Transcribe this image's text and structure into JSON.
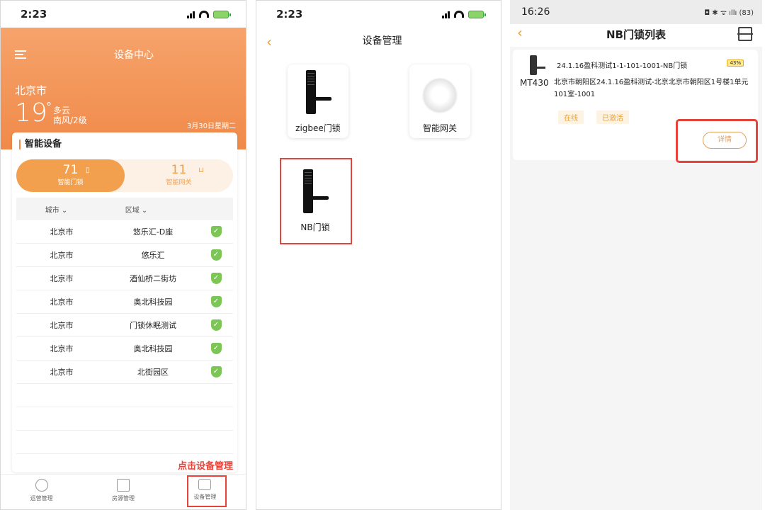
{
  "screen1": {
    "time": "2:23",
    "title": "设备中心",
    "city": "北京市",
    "temperature": "19",
    "degree": "°",
    "weather": "多云",
    "wind": "南风/2级",
    "date": "3月30日星期二",
    "card_title": "智能设备",
    "tab_locks_count": "71",
    "tab_locks_label": "智能门锁",
    "tab_gateways_count": "11",
    "tab_gateways_label": "智能网关",
    "col_city": "城市",
    "col_area": "区域",
    "rows": [
      {
        "city": "北京市",
        "area": "悠乐汇-D座"
      },
      {
        "city": "北京市",
        "area": "悠乐汇"
      },
      {
        "city": "北京市",
        "area": "酒仙桥二街坊"
      },
      {
        "city": "北京市",
        "area": "奥北科技园"
      },
      {
        "city": "北京市",
        "area": "门锁休眠测试"
      },
      {
        "city": "北京市",
        "area": "奥北科技园"
      },
      {
        "city": "北京市",
        "area": "北街园区"
      }
    ],
    "hint": "点击设备管理",
    "tab_ops": "运营管理",
    "tab_house": "房源管理",
    "tab_device": "设备管理"
  },
  "screen2": {
    "time": "2:23",
    "title": "设备管理",
    "zigbee_label": "zigbee门锁",
    "gateway_label": "智能网关",
    "nb_label": "NB门锁"
  },
  "screen3": {
    "time": "16:26",
    "battery": "83",
    "title": "NB门锁列表",
    "model": "MT430",
    "lock_name": "24.1.16盈科测试1-1-101-1001-NB门锁",
    "battery_badge": "43%",
    "address": "北京市朝阳区24.1.16盈科测试-北京北京市朝阳区1号楼1单元101室-1001",
    "tag_online": "在线",
    "tag_active": "已激活",
    "detail_label": "详情"
  }
}
